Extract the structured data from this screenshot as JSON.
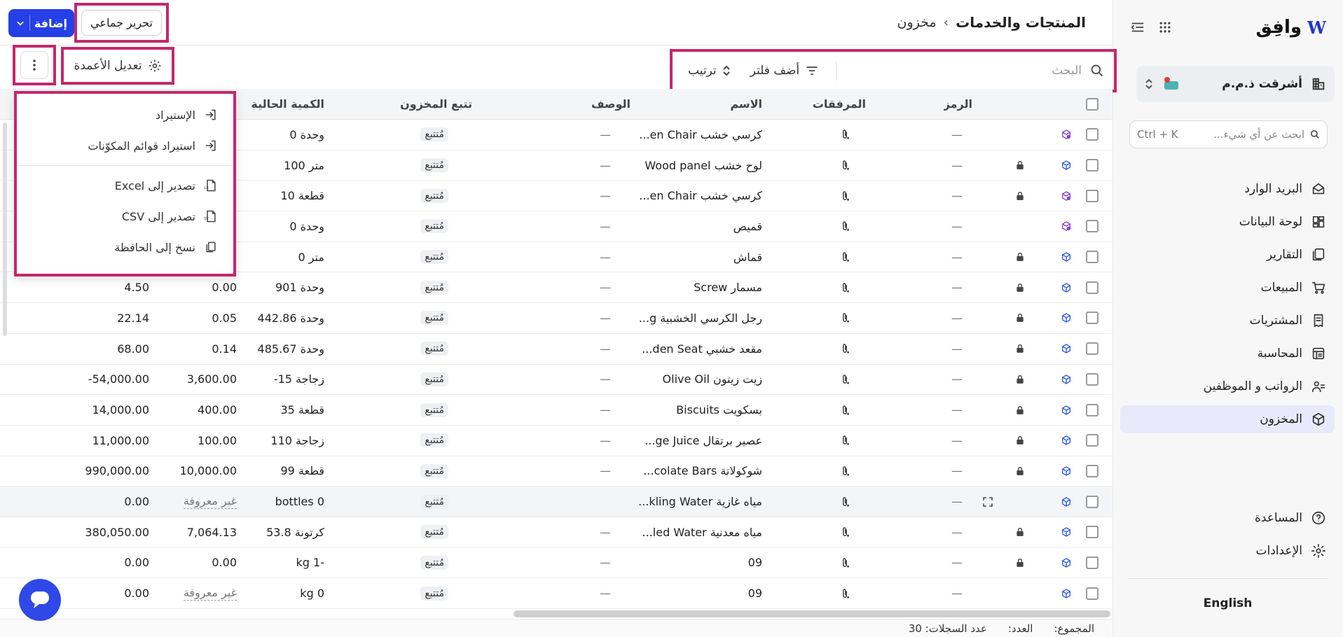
{
  "brand": {
    "logo_text": "وافِق",
    "logo_mark": "W"
  },
  "sidebar": {
    "org_name": "أشرقت ذ.م.م",
    "search_placeholder": "ابحث عن أي شيء...",
    "search_shortcut": "Ctrl + K",
    "items": [
      {
        "label": "البريد الوارد",
        "icon": "inbox-icon"
      },
      {
        "label": "لوحة البيانات",
        "icon": "dashboard-icon"
      },
      {
        "label": "التقارير",
        "icon": "reports-icon"
      },
      {
        "label": "المبيعات",
        "icon": "cart-icon"
      },
      {
        "label": "المشتريات",
        "icon": "receipt-icon"
      },
      {
        "label": "المحاسبة",
        "icon": "ledger-icon"
      },
      {
        "label": "الرواتب و الموظفين",
        "icon": "people-icon"
      },
      {
        "label": "المخزون",
        "icon": "cube-icon",
        "active": true
      }
    ],
    "bottom_items": [
      {
        "label": "المساعدة",
        "icon": "help-icon"
      },
      {
        "label": "الإعدادات",
        "icon": "gear-icon"
      }
    ],
    "language": "English"
  },
  "header": {
    "breadcrumb_root": "مخزون",
    "breadcrumb_sep": "›",
    "title": "المنتجات والخدمات",
    "add_label": "إضافة",
    "bulk_edit_label": "تحرير جماعي"
  },
  "toolbar": {
    "search_placeholder": "البحث",
    "filter_label": "أضف فلتر",
    "sort_label": "ترتيب",
    "columns_label": "تعديل الأعمدة"
  },
  "table": {
    "columns": {
      "code": "الرمز",
      "attachments": "المرفقات",
      "name": "الاسم",
      "description": "الوصف",
      "tracking": "تتبع المخزون",
      "qty": "الكمية الحالية",
      "cost": "",
      "value": ""
    },
    "rows": [
      {
        "type": "assembly",
        "locked": false,
        "code": "—",
        "name": "كرسي خشب en Chair...",
        "desc": "—",
        "tracking": "مُتتبع",
        "qty": "وحدة 0",
        "cost": "",
        "value": ""
      },
      {
        "type": "product",
        "locked": true,
        "code": "—",
        "name": "لوح خشب Wood panel",
        "desc": "—",
        "tracking": "مُتتبع",
        "qty": "متر 100",
        "cost": "",
        "value": ""
      },
      {
        "type": "assembly",
        "locked": true,
        "code": "—",
        "name": "كرسي خشب en Chair...",
        "desc": "—",
        "tracking": "مُتتبع",
        "qty": "قطعة 10",
        "cost": "",
        "value": ""
      },
      {
        "type": "assembly",
        "locked": false,
        "code": "—",
        "name": "قميص",
        "desc": "—",
        "tracking": "مُتتبع",
        "qty": "وحدة 0",
        "cost": "",
        "value": ""
      },
      {
        "type": "product",
        "locked": true,
        "code": "—",
        "name": "قماش",
        "desc": "—",
        "tracking": "مُتتبع",
        "qty": "متر 0",
        "cost": "",
        "value": ""
      },
      {
        "type": "product",
        "locked": true,
        "code": "—",
        "name": "مسمار Screw",
        "desc": "—",
        "tracking": "مُتتبع",
        "qty": "وحدة 901",
        "cost": "0.00",
        "value": "4.50"
      },
      {
        "type": "product",
        "locked": true,
        "code": "—",
        "name": "رجل الكرسي الخشبية g...",
        "desc": "—",
        "tracking": "مُتتبع",
        "qty": "وحدة 442.86",
        "cost": "0.05",
        "value": "22.14"
      },
      {
        "type": "product",
        "locked": true,
        "code": "—",
        "name": "مقعد خشبي den Seat...",
        "desc": "—",
        "tracking": "مُتتبع",
        "qty": "وحدة 485.67",
        "cost": "0.14",
        "value": "68.00"
      },
      {
        "type": "product",
        "locked": true,
        "code": "—",
        "name": "زيت زيتون Olive Oil",
        "desc": "—",
        "tracking": "مُتتبع",
        "qty": "زجاجة 15-",
        "cost": "3,600.00",
        "value": "-54,000.00"
      },
      {
        "type": "product",
        "locked": true,
        "code": "—",
        "name": "بسكويت Biscuits",
        "desc": "—",
        "tracking": "مُتتبع",
        "qty": "قطعة 35",
        "cost": "400.00",
        "value": "14,000.00"
      },
      {
        "type": "product",
        "locked": true,
        "code": "—",
        "name": "عصير برتقال ge Juice...",
        "desc": "—",
        "tracking": "مُتتبع",
        "qty": "زجاجة 110",
        "cost": "100.00",
        "value": "11,000.00"
      },
      {
        "type": "product",
        "locked": true,
        "code": "—",
        "name": "شوكولاتة colate Bars...",
        "desc": "—",
        "tracking": "مُتتبع",
        "qty": "قطعة 99",
        "cost": "10,000.00",
        "value": "990,000.00"
      },
      {
        "type": "product",
        "locked": false,
        "expand": true,
        "highlight": true,
        "code": "—",
        "name": "مياه غازية kling Water...",
        "desc": "",
        "tracking": "مُتتبع",
        "qty": "0 bottles",
        "cost": "غير معروفة",
        "value": "0.00"
      },
      {
        "type": "product",
        "locked": true,
        "code": "—",
        "name": "مياه معدنية led Water...",
        "desc": "—",
        "tracking": "مُتتبع",
        "qty": "كرتونة 53.8",
        "cost": "7,064.13",
        "value": "380,050.00"
      },
      {
        "type": "product",
        "locked": true,
        "code": "—",
        "name": "09",
        "desc": "—",
        "tracking": "مُتتبع",
        "qty": "-1 kg",
        "cost": "0.00",
        "value": "0.00"
      },
      {
        "type": "product",
        "locked": false,
        "code": "—",
        "name": "09",
        "desc": "—",
        "tracking": "مُتتبع",
        "qty": "0 kg",
        "cost": "غير معروفة",
        "value": "0.00"
      }
    ]
  },
  "menu": {
    "items": [
      {
        "label": "الإستيراد",
        "icon": "import-icon"
      },
      {
        "label": "استيراد قوائم المكوّنات",
        "icon": "import-bom-icon"
      },
      {
        "separator": true
      },
      {
        "label": "تصدير إلى Excel",
        "icon": "xls-file-icon"
      },
      {
        "label": "تصدير إلى CSV",
        "icon": "csv-file-icon"
      },
      {
        "label": "نسخ إلى الحافظة",
        "icon": "clipboard-icon"
      }
    ]
  },
  "footer": {
    "total": "المجموع:",
    "count": "العدد:",
    "records": "عدد السجلات: 30"
  },
  "colors": {
    "accent": "#2440e6",
    "highlight_border": "#c4286b",
    "product_icon": "#2f5bea",
    "assembly_icon": "#8a3fd6"
  }
}
